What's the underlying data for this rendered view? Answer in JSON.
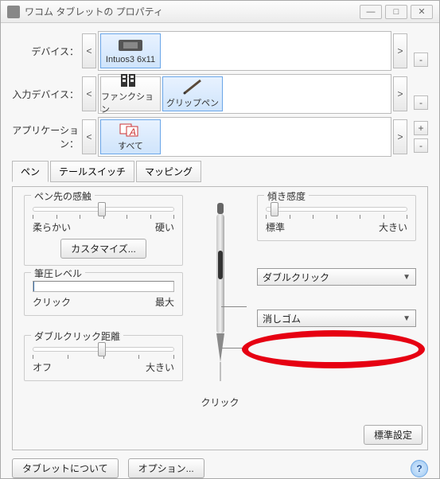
{
  "window": {
    "title": "ワコム タブレットの プロパティ"
  },
  "rows": {
    "device_label": "デバイス：",
    "tool_label": "入力デバイス：",
    "app_label": "アプリケーション：",
    "prev": "<",
    "next": ">",
    "plus": "+",
    "minus": "-"
  },
  "device_card": {
    "label": "Intuos3 6x11"
  },
  "tool_cards": {
    "functions": "ファンクション",
    "grip_pen": "グリップペン"
  },
  "app_cards": {
    "all": "すべて"
  },
  "tabs": {
    "pen": "ペン",
    "tail": "テールスイッチ",
    "mapping": "マッピング"
  },
  "pen_tab": {
    "tip_feel_title": "ペン先の感触",
    "tip_feel_min": "柔らかい",
    "tip_feel_max": "硬い",
    "customize": "カスタマイズ...",
    "pressure_title": "筆圧レベル",
    "pressure_min": "クリック",
    "pressure_max": "最大",
    "tilt_title": "傾き感度",
    "tilt_min": "標準",
    "tilt_max": "大きい",
    "upper_combo": "ダブルクリック",
    "lower_combo": "消しゴム",
    "click_label": "クリック",
    "dbl_title": "ダブルクリック距離",
    "dbl_min": "オフ",
    "dbl_max": "大きい"
  },
  "footer": {
    "defaults": "標準設定",
    "about": "タブレットについて",
    "options": "オプション..."
  }
}
